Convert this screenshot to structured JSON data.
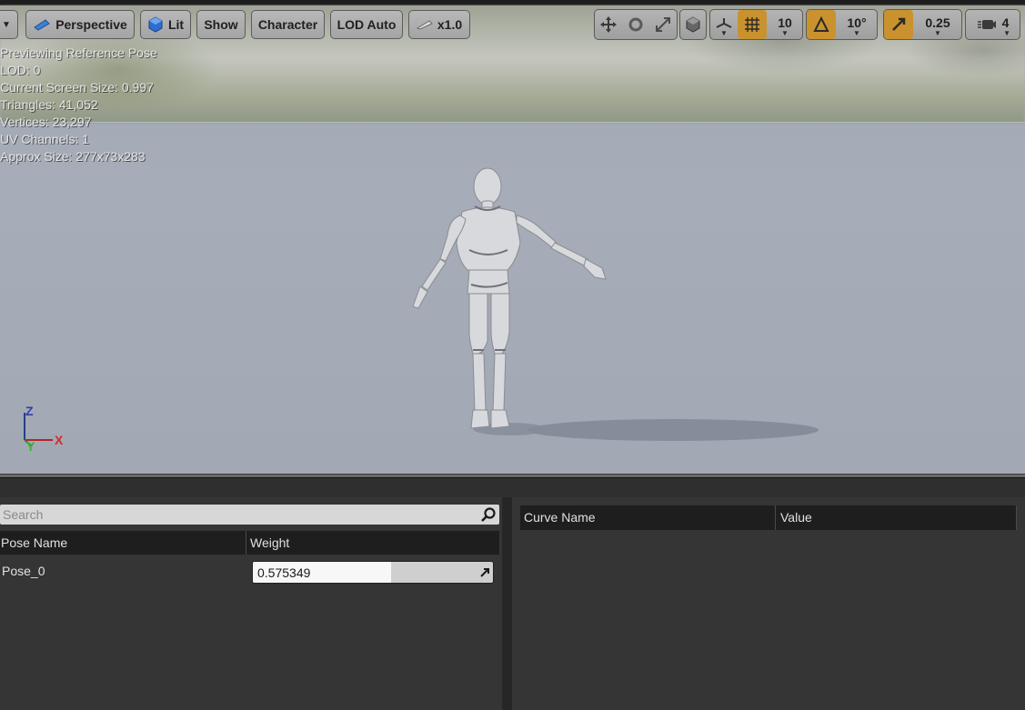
{
  "toolbar": {
    "perspective_label": "Perspective",
    "lit_label": "Lit",
    "show_label": "Show",
    "character_label": "Character",
    "lod_label": "LOD Auto",
    "speed_label": "x1.0",
    "grid_snap_value": "10",
    "rotation_snap_value": "10°",
    "scale_snap_value": "0.25",
    "camera_speed_value": "4",
    "accent_color": "#c9922f"
  },
  "viewport": {
    "stats": [
      "Previewing Reference Pose",
      "LOD: 0",
      "Current Screen Size: 0.997",
      "Triangles: 41,052",
      "Vertices: 23,297",
      "UV Channels: 1",
      "Approx Size: 277x73x283"
    ],
    "axis": {
      "z": "Z",
      "x": "X",
      "y": "Y"
    }
  },
  "pose_panel": {
    "search_placeholder": "Search",
    "search_value": "",
    "columns": [
      "Pose Name",
      "Weight"
    ],
    "rows": [
      {
        "name": "Pose_0",
        "weight": "0.575349",
        "weight_fraction": 0.575349
      }
    ]
  },
  "curve_panel": {
    "columns": [
      "Curve Name",
      "Value"
    ]
  }
}
